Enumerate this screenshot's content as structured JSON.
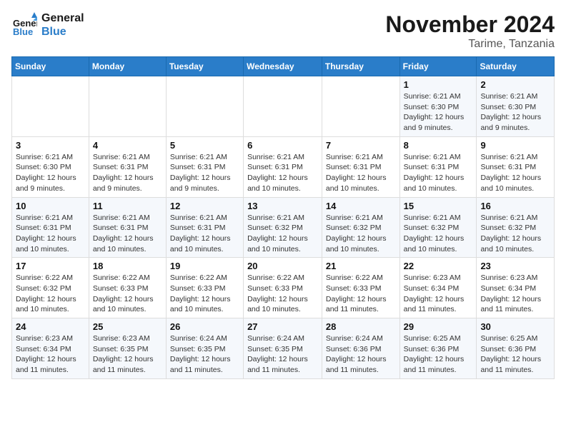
{
  "header": {
    "logo_line1": "General",
    "logo_line2": "Blue",
    "month": "November 2024",
    "location": "Tarime, Tanzania"
  },
  "weekdays": [
    "Sunday",
    "Monday",
    "Tuesday",
    "Wednesday",
    "Thursday",
    "Friday",
    "Saturday"
  ],
  "weeks": [
    [
      {
        "num": "",
        "detail": ""
      },
      {
        "num": "",
        "detail": ""
      },
      {
        "num": "",
        "detail": ""
      },
      {
        "num": "",
        "detail": ""
      },
      {
        "num": "",
        "detail": ""
      },
      {
        "num": "1",
        "detail": "Sunrise: 6:21 AM\nSunset: 6:30 PM\nDaylight: 12 hours\nand 9 minutes."
      },
      {
        "num": "2",
        "detail": "Sunrise: 6:21 AM\nSunset: 6:30 PM\nDaylight: 12 hours\nand 9 minutes."
      }
    ],
    [
      {
        "num": "3",
        "detail": "Sunrise: 6:21 AM\nSunset: 6:30 PM\nDaylight: 12 hours\nand 9 minutes."
      },
      {
        "num": "4",
        "detail": "Sunrise: 6:21 AM\nSunset: 6:31 PM\nDaylight: 12 hours\nand 9 minutes."
      },
      {
        "num": "5",
        "detail": "Sunrise: 6:21 AM\nSunset: 6:31 PM\nDaylight: 12 hours\nand 9 minutes."
      },
      {
        "num": "6",
        "detail": "Sunrise: 6:21 AM\nSunset: 6:31 PM\nDaylight: 12 hours\nand 10 minutes."
      },
      {
        "num": "7",
        "detail": "Sunrise: 6:21 AM\nSunset: 6:31 PM\nDaylight: 12 hours\nand 10 minutes."
      },
      {
        "num": "8",
        "detail": "Sunrise: 6:21 AM\nSunset: 6:31 PM\nDaylight: 12 hours\nand 10 minutes."
      },
      {
        "num": "9",
        "detail": "Sunrise: 6:21 AM\nSunset: 6:31 PM\nDaylight: 12 hours\nand 10 minutes."
      }
    ],
    [
      {
        "num": "10",
        "detail": "Sunrise: 6:21 AM\nSunset: 6:31 PM\nDaylight: 12 hours\nand 10 minutes."
      },
      {
        "num": "11",
        "detail": "Sunrise: 6:21 AM\nSunset: 6:31 PM\nDaylight: 12 hours\nand 10 minutes."
      },
      {
        "num": "12",
        "detail": "Sunrise: 6:21 AM\nSunset: 6:31 PM\nDaylight: 12 hours\nand 10 minutes."
      },
      {
        "num": "13",
        "detail": "Sunrise: 6:21 AM\nSunset: 6:32 PM\nDaylight: 12 hours\nand 10 minutes."
      },
      {
        "num": "14",
        "detail": "Sunrise: 6:21 AM\nSunset: 6:32 PM\nDaylight: 12 hours\nand 10 minutes."
      },
      {
        "num": "15",
        "detail": "Sunrise: 6:21 AM\nSunset: 6:32 PM\nDaylight: 12 hours\nand 10 minutes."
      },
      {
        "num": "16",
        "detail": "Sunrise: 6:21 AM\nSunset: 6:32 PM\nDaylight: 12 hours\nand 10 minutes."
      }
    ],
    [
      {
        "num": "17",
        "detail": "Sunrise: 6:22 AM\nSunset: 6:32 PM\nDaylight: 12 hours\nand 10 minutes."
      },
      {
        "num": "18",
        "detail": "Sunrise: 6:22 AM\nSunset: 6:33 PM\nDaylight: 12 hours\nand 10 minutes."
      },
      {
        "num": "19",
        "detail": "Sunrise: 6:22 AM\nSunset: 6:33 PM\nDaylight: 12 hours\nand 10 minutes."
      },
      {
        "num": "20",
        "detail": "Sunrise: 6:22 AM\nSunset: 6:33 PM\nDaylight: 12 hours\nand 10 minutes."
      },
      {
        "num": "21",
        "detail": "Sunrise: 6:22 AM\nSunset: 6:33 PM\nDaylight: 12 hours\nand 11 minutes."
      },
      {
        "num": "22",
        "detail": "Sunrise: 6:23 AM\nSunset: 6:34 PM\nDaylight: 12 hours\nand 11 minutes."
      },
      {
        "num": "23",
        "detail": "Sunrise: 6:23 AM\nSunset: 6:34 PM\nDaylight: 12 hours\nand 11 minutes."
      }
    ],
    [
      {
        "num": "24",
        "detail": "Sunrise: 6:23 AM\nSunset: 6:34 PM\nDaylight: 12 hours\nand 11 minutes."
      },
      {
        "num": "25",
        "detail": "Sunrise: 6:23 AM\nSunset: 6:35 PM\nDaylight: 12 hours\nand 11 minutes."
      },
      {
        "num": "26",
        "detail": "Sunrise: 6:24 AM\nSunset: 6:35 PM\nDaylight: 12 hours\nand 11 minutes."
      },
      {
        "num": "27",
        "detail": "Sunrise: 6:24 AM\nSunset: 6:35 PM\nDaylight: 12 hours\nand 11 minutes."
      },
      {
        "num": "28",
        "detail": "Sunrise: 6:24 AM\nSunset: 6:36 PM\nDaylight: 12 hours\nand 11 minutes."
      },
      {
        "num": "29",
        "detail": "Sunrise: 6:25 AM\nSunset: 6:36 PM\nDaylight: 12 hours\nand 11 minutes."
      },
      {
        "num": "30",
        "detail": "Sunrise: 6:25 AM\nSunset: 6:36 PM\nDaylight: 12 hours\nand 11 minutes."
      }
    ]
  ]
}
